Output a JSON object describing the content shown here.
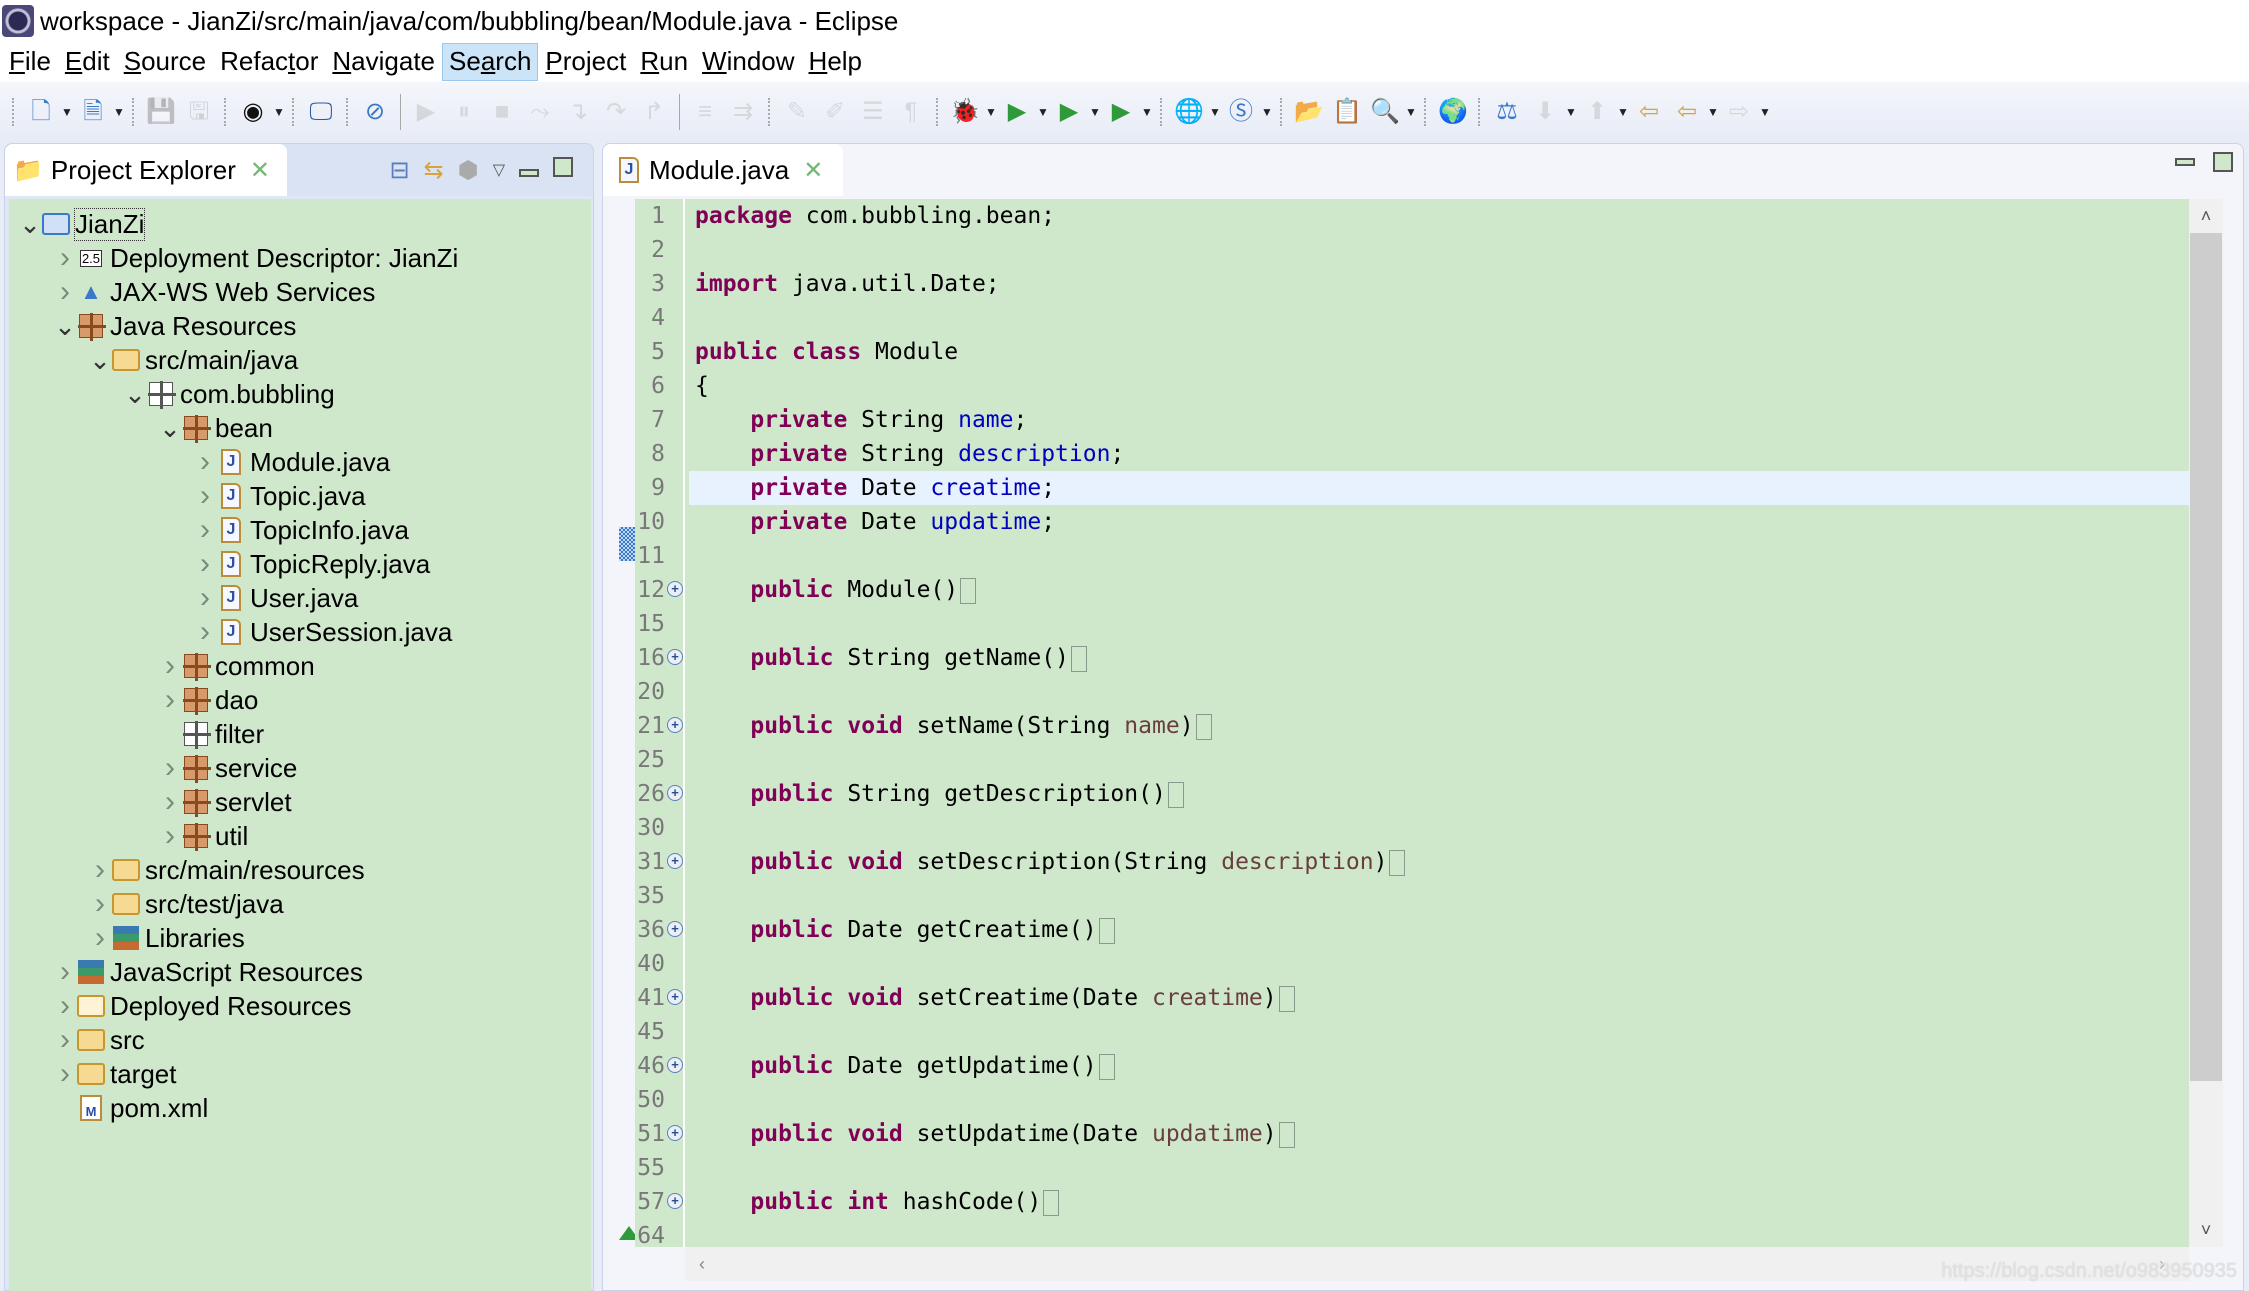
{
  "window": {
    "title": "workspace - JianZi/src/main/java/com/bubbling/bean/Module.java - Eclipse",
    "app_icon": "eclipse-icon"
  },
  "menu": [
    {
      "label": "File",
      "mnemonic": "F",
      "rest": "ile",
      "active": false
    },
    {
      "label": "Edit",
      "mnemonic": "E",
      "rest": "dit",
      "active": false
    },
    {
      "label": "Source",
      "mnemonic": "S",
      "rest": "ource",
      "active": false
    },
    {
      "label": "Refactor",
      "pre": "Refac",
      "mnemonic": "t",
      "rest": "or",
      "active": false
    },
    {
      "label": "Navigate",
      "mnemonic": "N",
      "rest": "avigate",
      "active": false
    },
    {
      "label": "Search",
      "pre": "Se",
      "mnemonic": "a",
      "rest": "rch",
      "active": true
    },
    {
      "label": "Project",
      "mnemonic": "P",
      "rest": "roject",
      "active": false
    },
    {
      "label": "Run",
      "mnemonic": "R",
      "rest": "un",
      "active": false
    },
    {
      "label": "Window",
      "mnemonic": "W",
      "rest": "indow",
      "active": false
    },
    {
      "label": "Help",
      "mnemonic": "H",
      "rest": "elp",
      "active": false
    }
  ],
  "toolbar": {
    "icons": [
      "new-wizard-icon",
      "new-class-icon",
      "save-icon",
      "save-all-icon",
      "user-icon",
      "console-icon",
      "skip-breakpoints-icon",
      "resume-icon",
      "suspend-icon",
      "terminate-icon",
      "disconnect-icon",
      "step-into-icon",
      "step-over-icon",
      "step-return-icon",
      "drop-to-frame-icon",
      "use-step-filters-icon",
      "toggle-mark-occurrences-icon",
      "highlight-icon",
      "block-selection-icon",
      "show-whitespace-icon",
      "debug-icon",
      "run-icon",
      "coverage-icon",
      "external-tools-icon",
      "new-server-icon",
      "new-spring-icon",
      "open-type-icon",
      "open-task-icon",
      "search-icon",
      "web-browser-icon",
      "deploy-icon",
      "next-annotation-icon",
      "previous-annotation-icon",
      "last-edit-icon",
      "back-icon",
      "forward-icon"
    ]
  },
  "project_explorer": {
    "tab_label": "Project Explorer",
    "tree": [
      {
        "label": "JianZi",
        "depth": 0,
        "expanded": true,
        "has_children": true,
        "icon": "maven-project-icon",
        "focused": true
      },
      {
        "label": "Deployment Descriptor: JianZi",
        "depth": 1,
        "expanded": false,
        "has_children": true,
        "icon": "deployment-descriptor-icon"
      },
      {
        "label": "JAX-WS Web Services",
        "depth": 1,
        "expanded": false,
        "has_children": true,
        "icon": "web-services-icon"
      },
      {
        "label": "Java Resources",
        "depth": 1,
        "expanded": true,
        "has_children": true,
        "icon": "java-resources-icon"
      },
      {
        "label": "src/main/java",
        "depth": 2,
        "expanded": true,
        "has_children": true,
        "icon": "source-folder-icon"
      },
      {
        "label": "com.bubbling",
        "depth": 3,
        "expanded": true,
        "has_children": true,
        "icon": "empty-package-icon"
      },
      {
        "label": "bean",
        "depth": 4,
        "expanded": true,
        "has_children": true,
        "icon": "package-icon"
      },
      {
        "label": "Module.java",
        "depth": 5,
        "expanded": false,
        "has_children": true,
        "icon": "java-file-icon"
      },
      {
        "label": "Topic.java",
        "depth": 5,
        "expanded": false,
        "has_children": true,
        "icon": "java-file-icon"
      },
      {
        "label": "TopicInfo.java",
        "depth": 5,
        "expanded": false,
        "has_children": true,
        "icon": "java-file-icon"
      },
      {
        "label": "TopicReply.java",
        "depth": 5,
        "expanded": false,
        "has_children": true,
        "icon": "java-file-icon"
      },
      {
        "label": "User.java",
        "depth": 5,
        "expanded": false,
        "has_children": true,
        "icon": "java-file-icon"
      },
      {
        "label": "UserSession.java",
        "depth": 5,
        "expanded": false,
        "has_children": true,
        "icon": "java-file-icon"
      },
      {
        "label": "common",
        "depth": 4,
        "expanded": false,
        "has_children": true,
        "icon": "package-icon"
      },
      {
        "label": "dao",
        "depth": 4,
        "expanded": false,
        "has_children": true,
        "icon": "package-icon"
      },
      {
        "label": "filter",
        "depth": 4,
        "expanded": false,
        "has_children": false,
        "icon": "empty-package-icon"
      },
      {
        "label": "service",
        "depth": 4,
        "expanded": false,
        "has_children": true,
        "icon": "package-icon"
      },
      {
        "label": "servlet",
        "depth": 4,
        "expanded": false,
        "has_children": true,
        "icon": "package-icon"
      },
      {
        "label": "util",
        "depth": 4,
        "expanded": false,
        "has_children": true,
        "icon": "package-icon"
      },
      {
        "label": "src/main/resources",
        "depth": 2,
        "expanded": false,
        "has_children": true,
        "icon": "source-folder-icon"
      },
      {
        "label": "src/test/java",
        "depth": 2,
        "expanded": false,
        "has_children": true,
        "icon": "source-folder-icon"
      },
      {
        "label": "Libraries",
        "depth": 2,
        "expanded": false,
        "has_children": true,
        "icon": "libraries-icon"
      },
      {
        "label": "JavaScript Resources",
        "depth": 1,
        "expanded": false,
        "has_children": true,
        "icon": "javascript-resources-icon"
      },
      {
        "label": "Deployed Resources",
        "depth": 1,
        "expanded": false,
        "has_children": true,
        "icon": "deployed-resources-icon"
      },
      {
        "label": "src",
        "depth": 1,
        "expanded": false,
        "has_children": true,
        "icon": "folder-icon"
      },
      {
        "label": "target",
        "depth": 1,
        "expanded": false,
        "has_children": true,
        "icon": "folder-icon"
      },
      {
        "label": "pom.xml",
        "depth": 1,
        "expanded": false,
        "has_children": false,
        "icon": "maven-pom-icon"
      }
    ]
  },
  "editor": {
    "tab_label": "Module.java",
    "current_line": 9,
    "lines": [
      {
        "n": "1",
        "tokens": [
          [
            "kw",
            "package"
          ],
          [
            "t",
            " com.bubbling.bean;"
          ]
        ]
      },
      {
        "n": "2",
        "tokens": []
      },
      {
        "n": "3",
        "tokens": [
          [
            "kw",
            "import"
          ],
          [
            "t",
            " java.util.Date;"
          ]
        ]
      },
      {
        "n": "4",
        "tokens": []
      },
      {
        "n": "5",
        "tokens": [
          [
            "kw",
            "public"
          ],
          [
            "t",
            " "
          ],
          [
            "kw",
            "class"
          ],
          [
            "t",
            " Module"
          ]
        ]
      },
      {
        "n": "6",
        "tokens": [
          [
            "t",
            "{"
          ]
        ]
      },
      {
        "n": "7",
        "tokens": [
          [
            "t",
            "    "
          ],
          [
            "kw",
            "private"
          ],
          [
            "t",
            " String "
          ],
          [
            "fld",
            "name"
          ],
          [
            "t",
            ";"
          ]
        ]
      },
      {
        "n": "8",
        "tokens": [
          [
            "t",
            "    "
          ],
          [
            "kw",
            "private"
          ],
          [
            "t",
            " String "
          ],
          [
            "fld",
            "description"
          ],
          [
            "t",
            ";"
          ]
        ]
      },
      {
        "n": "9",
        "tokens": [
          [
            "t",
            "    "
          ],
          [
            "kw",
            "private"
          ],
          [
            "t",
            " Date "
          ],
          [
            "fld",
            "creatime"
          ],
          [
            "t",
            ";"
          ]
        ]
      },
      {
        "n": "10",
        "tokens": [
          [
            "t",
            "    "
          ],
          [
            "kw",
            "private"
          ],
          [
            "t",
            " Date "
          ],
          [
            "fld",
            "updatime"
          ],
          [
            "t",
            ";"
          ]
        ]
      },
      {
        "n": "11",
        "tokens": []
      },
      {
        "n": "12",
        "fold": true,
        "collapsed": true,
        "tokens": [
          [
            "t",
            "    "
          ],
          [
            "kw",
            "public"
          ],
          [
            "t",
            " Module()"
          ]
        ]
      },
      {
        "n": "15",
        "tokens": []
      },
      {
        "n": "16",
        "fold": true,
        "collapsed": true,
        "tokens": [
          [
            "t",
            "    "
          ],
          [
            "kw",
            "public"
          ],
          [
            "t",
            " String getName()"
          ]
        ]
      },
      {
        "n": "20",
        "tokens": []
      },
      {
        "n": "21",
        "fold": true,
        "collapsed": true,
        "tokens": [
          [
            "t",
            "    "
          ],
          [
            "kw",
            "public"
          ],
          [
            "t",
            " "
          ],
          [
            "kw",
            "void"
          ],
          [
            "t",
            " setName(String "
          ],
          [
            "prm",
            "name"
          ],
          [
            "t",
            ")"
          ]
        ]
      },
      {
        "n": "25",
        "tokens": []
      },
      {
        "n": "26",
        "fold": true,
        "collapsed": true,
        "tokens": [
          [
            "t",
            "    "
          ],
          [
            "kw",
            "public"
          ],
          [
            "t",
            " String getDescription()"
          ]
        ]
      },
      {
        "n": "30",
        "tokens": []
      },
      {
        "n": "31",
        "fold": true,
        "collapsed": true,
        "tokens": [
          [
            "t",
            "    "
          ],
          [
            "kw",
            "public"
          ],
          [
            "t",
            " "
          ],
          [
            "kw",
            "void"
          ],
          [
            "t",
            " setDescription(String "
          ],
          [
            "prm",
            "description"
          ],
          [
            "t",
            ")"
          ]
        ]
      },
      {
        "n": "35",
        "tokens": []
      },
      {
        "n": "36",
        "fold": true,
        "collapsed": true,
        "tokens": [
          [
            "t",
            "    "
          ],
          [
            "kw",
            "public"
          ],
          [
            "t",
            " Date getCreatime()"
          ]
        ]
      },
      {
        "n": "40",
        "tokens": []
      },
      {
        "n": "41",
        "fold": true,
        "collapsed": true,
        "tokens": [
          [
            "t",
            "    "
          ],
          [
            "kw",
            "public"
          ],
          [
            "t",
            " "
          ],
          [
            "kw",
            "void"
          ],
          [
            "t",
            " setCreatime(Date "
          ],
          [
            "prm",
            "creatime"
          ],
          [
            "t",
            ")"
          ]
        ]
      },
      {
        "n": "45",
        "tokens": []
      },
      {
        "n": "46",
        "fold": true,
        "collapsed": true,
        "tokens": [
          [
            "t",
            "    "
          ],
          [
            "kw",
            "public"
          ],
          [
            "t",
            " Date getUpdatime()"
          ]
        ]
      },
      {
        "n": "50",
        "tokens": []
      },
      {
        "n": "51",
        "fold": true,
        "collapsed": true,
        "tokens": [
          [
            "t",
            "    "
          ],
          [
            "kw",
            "public"
          ],
          [
            "t",
            " "
          ],
          [
            "kw",
            "void"
          ],
          [
            "t",
            " setUpdatime(Date "
          ],
          [
            "prm",
            "updatime"
          ],
          [
            "t",
            ")"
          ]
        ]
      },
      {
        "n": "55",
        "tokens": []
      },
      {
        "n": "57",
        "fold": true,
        "collapsed": true,
        "override": true,
        "tokens": [
          [
            "t",
            "    "
          ],
          [
            "kw",
            "public"
          ],
          [
            "t",
            " "
          ],
          [
            "kw",
            "int"
          ],
          [
            "t",
            " hashCode()"
          ]
        ]
      },
      {
        "n": "64",
        "tokens": []
      }
    ]
  },
  "watermark": "https://blog.csdn.net/o983950935",
  "colors": {
    "editor_bg": "#cfe8cc",
    "keyword": "#7f0055",
    "field": "#0000c0",
    "parameter": "#6a3e3e",
    "current_line": "#e8f2fe",
    "menu_active": "#cce4f7"
  }
}
